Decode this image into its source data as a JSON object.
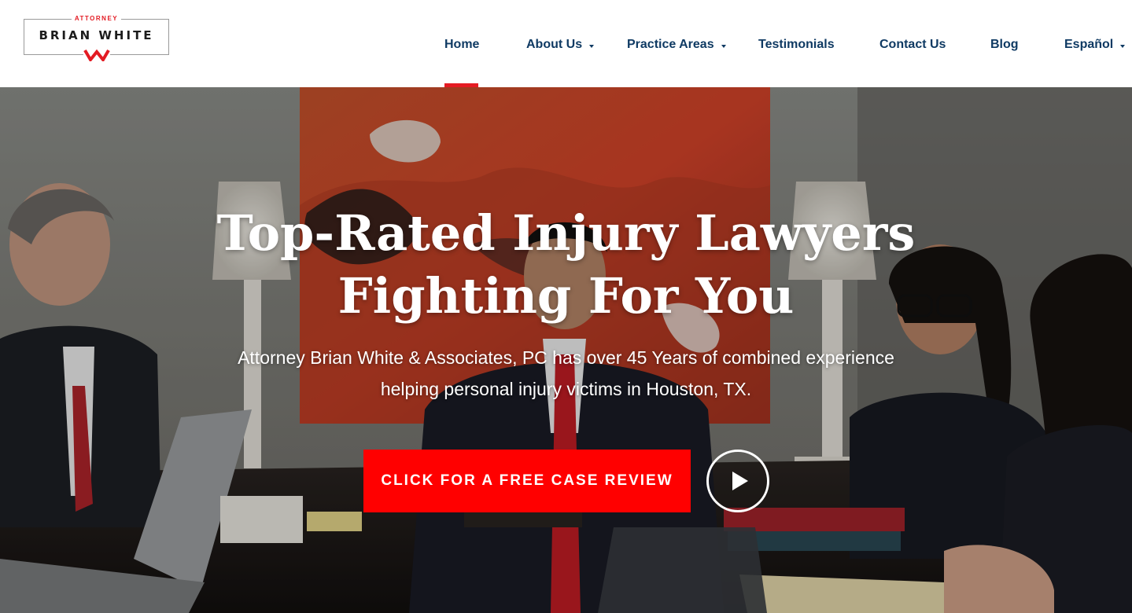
{
  "logo": {
    "top_text": "ATTORNEY",
    "main_text": "BRIAN WHITE",
    "mark_icon": "w-logo-mark",
    "mark_color": "#e31b23"
  },
  "nav": {
    "items": [
      {
        "label": "Home",
        "active": true,
        "has_dropdown": false
      },
      {
        "label": "About Us",
        "active": false,
        "has_dropdown": true
      },
      {
        "label": "Practice Areas",
        "active": false,
        "has_dropdown": true
      },
      {
        "label": "Testimonials",
        "active": false,
        "has_dropdown": false
      },
      {
        "label": "Contact Us",
        "active": false,
        "has_dropdown": false
      },
      {
        "label": "Blog",
        "active": false,
        "has_dropdown": false
      },
      {
        "label": "Español",
        "active": false,
        "has_dropdown": true
      }
    ],
    "text_color": "#0f3a63",
    "active_color": "#e51b23"
  },
  "hero": {
    "title_line1": "Top-Rated Injury Lawyers",
    "title_line2": "Fighting For You",
    "subtitle_line1": "Attorney Brian White & Associates, PC has over 45 Years of combined experience",
    "subtitle_line2": "helping personal injury victims in Houston, TX.",
    "cta_label": "CLICK FOR A FREE CASE REVIEW",
    "cta_color": "#ff0000",
    "play_icon": "play-icon"
  }
}
